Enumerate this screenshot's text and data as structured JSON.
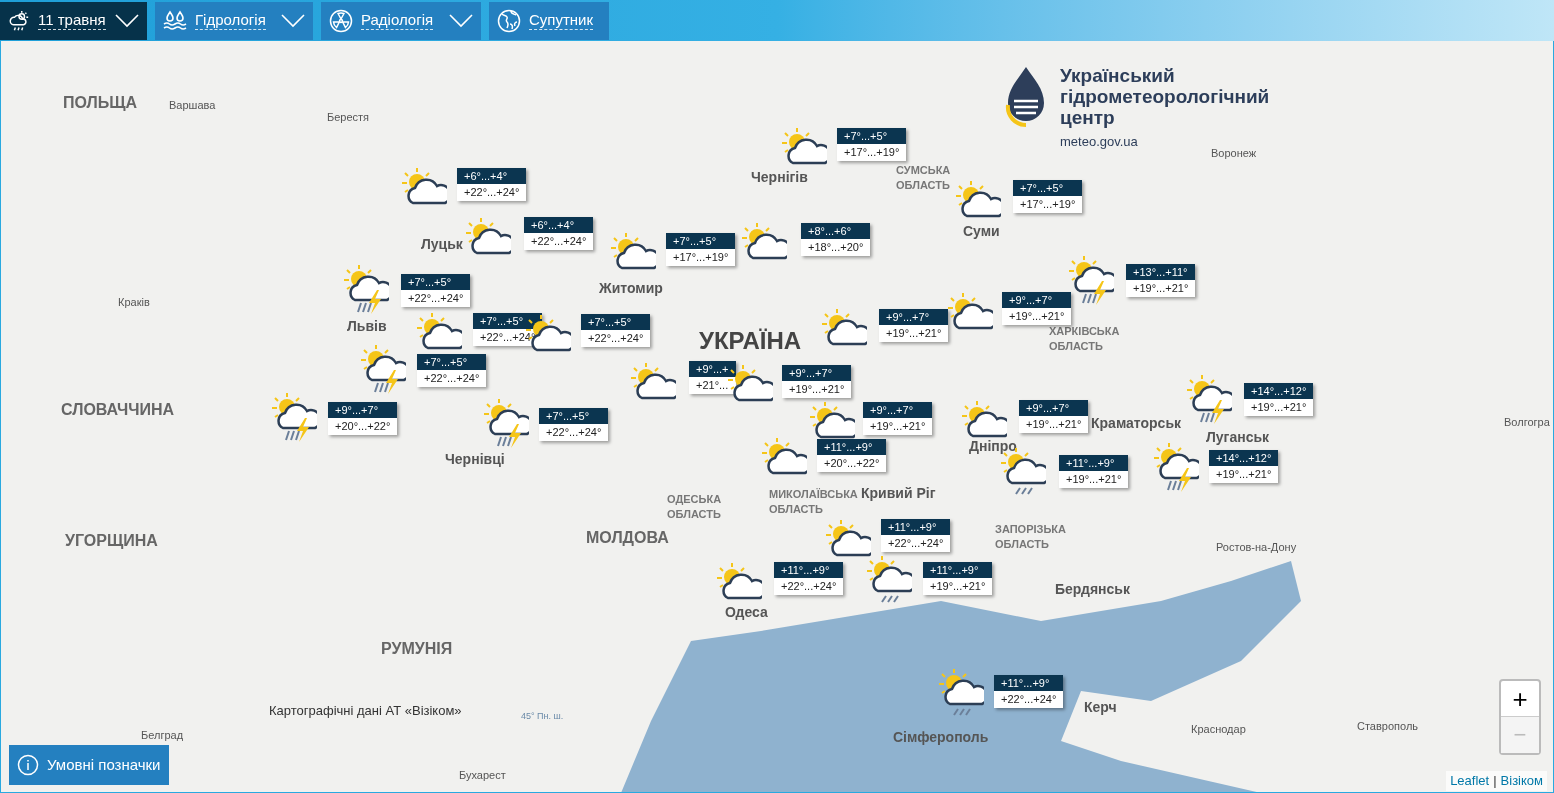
{
  "top_menu": [
    {
      "kind": "weather",
      "label": "11 травня",
      "selected": true,
      "dropdown": true
    },
    {
      "kind": "water",
      "label": "Гідрологія",
      "selected": false,
      "dropdown": true
    },
    {
      "kind": "radiation",
      "label": "Радіологія",
      "selected": false,
      "dropdown": true
    },
    {
      "kind": "globe",
      "label": "Супутник",
      "selected": false,
      "dropdown": false
    }
  ],
  "logo": {
    "lines": [
      "Український",
      "гідрометеорологічний",
      "центр"
    ],
    "url": "meteo.gov.ua"
  },
  "map": {
    "country_labels": [
      "ПОЛЬЩА",
      "СЛОВАЧЧИНА",
      "УГОРЩИНА",
      "РУМУНІЯ",
      "МОЛДОВА",
      "УКРАЇНА"
    ],
    "region_labels": [
      "СУМСЬКА ОБЛАСТЬ",
      "ХАРКІВСЬКА ОБЛАСТЬ",
      "ЗАПОРІЗЬКА ОБЛАСТЬ",
      "ОДЕСЬКА ОБЛАСТЬ",
      "МИКОЛАЇВСЬКА ОБЛАСТЬ"
    ],
    "city_labels": [
      "Варшава",
      "Берестя",
      "Краків",
      "Луцьк",
      "Львів",
      "Чернівці",
      "Житомир",
      "Чернігів",
      "Суми",
      "Дніпро",
      "Кривий Ріг",
      "Краматорськ",
      "Луганськ",
      "Одеса",
      "Бердянськ",
      "Сімферополь",
      "Керч",
      "Воронеж",
      "Волгогра",
      "Ростов-на-Дону",
      "Краснодар",
      "Ставрополь",
      "Белград",
      "Бухарест"
    ],
    "credit": "Картографічні дані АТ «Візіком»",
    "graticule_label": "45° Пн. ш.",
    "forecasts": [
      {
        "kind": "partly_cloudy",
        "night": "+6°...+4°",
        "day": "+22°...+24°"
      },
      {
        "kind": "partly_cloudy",
        "night": "+6°...+4°",
        "day": "+22°...+24°"
      },
      {
        "kind": "partly_cloudy",
        "night": "+7°...+5°",
        "day": "+17°...+19°"
      },
      {
        "kind": "thunderstorm",
        "night": "+7°...+5°",
        "day": "+22°...+24°"
      },
      {
        "kind": "partly_cloudy",
        "night": "+7°...+5°",
        "day": "+22°...+24°"
      },
      {
        "kind": "partly_cloudy",
        "night": "+7°...+5°",
        "day": "+22°...+24°"
      },
      {
        "kind": "thunderstorm",
        "night": "+7°...+5°",
        "day": "+22°...+24°"
      },
      {
        "kind": "thunderstorm",
        "night": "+9°...+7°",
        "day": "+20°...+22°"
      },
      {
        "kind": "thunderstorm",
        "night": "+7°...+5°",
        "day": "+22°...+24°"
      },
      {
        "kind": "partly_cloudy",
        "night": "+9°...+",
        "day": "+21°..."
      },
      {
        "kind": "partly_cloudy",
        "night": "+7°...+5°",
        "day": "+17°...+19°"
      },
      {
        "kind": "partly_cloudy",
        "night": "+8°...+6°",
        "day": "+18°...+20°"
      },
      {
        "kind": "partly_cloudy",
        "night": "+7°...+5°",
        "day": "+17°...+19°"
      },
      {
        "kind": "partly_cloudy",
        "night": "+9°...+7°",
        "day": "+19°...+21°"
      },
      {
        "kind": "partly_cloudy",
        "night": "+9°...+7°",
        "day": "+19°...+21°"
      },
      {
        "kind": "thunderstorm",
        "night": "+13°...+11°",
        "day": "+19°...+21°"
      },
      {
        "kind": "partly_cloudy",
        "night": "+9°...+7°",
        "day": "+19°...+21°"
      },
      {
        "kind": "partly_cloudy",
        "night": "+9°...+7°",
        "day": "+19°...+21°"
      },
      {
        "kind": "partly_cloudy",
        "night": "+9°...+7°",
        "day": "+19°...+21°"
      },
      {
        "kind": "thunderstorm",
        "night": "+14°...+12°",
        "day": "+19°...+21°"
      },
      {
        "kind": "partly_cloudy",
        "night": "+11°...+9°",
        "day": "+20°...+22°"
      },
      {
        "kind": "rain",
        "night": "+11°...+9°",
        "day": "+19°...+21°"
      },
      {
        "kind": "thunderstorm",
        "night": "+14°...+12°",
        "day": "+19°...+21°"
      },
      {
        "kind": "partly_cloudy",
        "night": "+11°...+9°",
        "day": "+22°...+24°"
      },
      {
        "kind": "partly_cloudy",
        "night": "+11°...+9°",
        "day": "+22°...+24°"
      },
      {
        "kind": "rain",
        "night": "+11°...+9°",
        "day": "+19°...+21°"
      },
      {
        "kind": "rain",
        "night": "+11°...+9°",
        "day": "+22°...+24°"
      }
    ]
  },
  "zoom_controls": {
    "zoom_in": "+",
    "zoom_out": "−",
    "zoom_out_disabled": true
  },
  "legend_button": "Умовні позначки",
  "attribution": {
    "links": [
      "Leaflet",
      "Візіком"
    ],
    "separator": "|"
  }
}
